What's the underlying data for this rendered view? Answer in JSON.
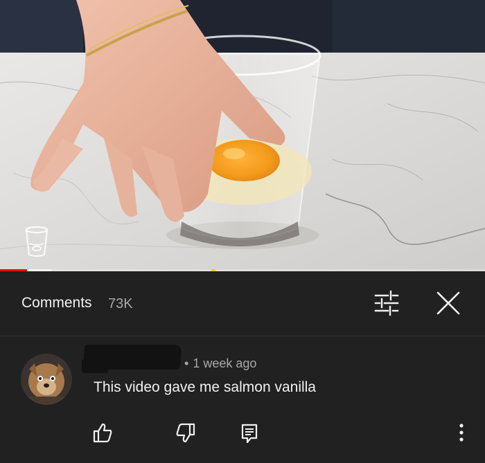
{
  "comments_panel": {
    "title": "Comments",
    "count": "73K"
  },
  "comment": {
    "time": "1 week ago",
    "separator": "•",
    "text": "This video gave me salmon vanilla"
  },
  "player": {
    "progress_fraction": 0.055
  },
  "icons": {
    "filter": "sliders-icon",
    "close": "close-icon",
    "like": "thumbs-up-icon",
    "dislike": "thumbs-down-icon",
    "reply": "reply-icon",
    "more": "more-vert-icon",
    "badge": "cup-icon"
  },
  "colors": {
    "background": "#212121",
    "text": "#f1f1f1",
    "muted": "#aaaaaa",
    "progress": "#ff0000"
  }
}
